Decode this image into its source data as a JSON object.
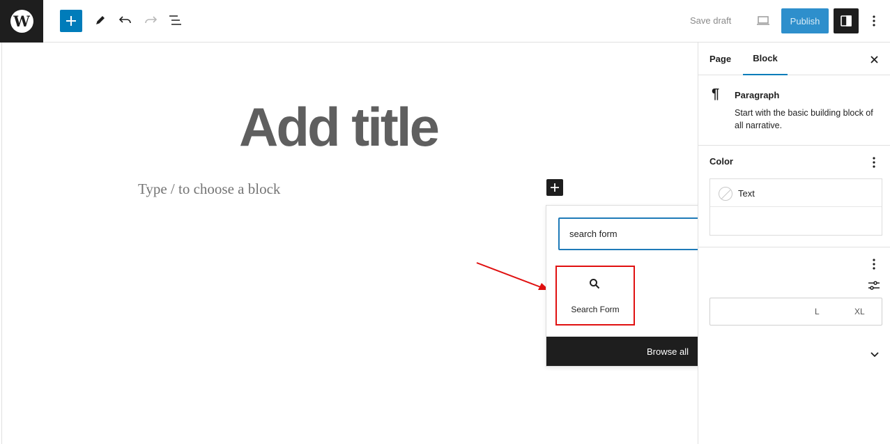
{
  "topbar": {
    "logo_icon": "wordpress-logo-icon",
    "logo_glyph": "W",
    "save_draft_label": "Save draft",
    "publish_label": "Publish",
    "icons": [
      "plus-icon",
      "pencil-icon",
      "undo-icon",
      "redo-icon",
      "list-view-icon",
      "desktop-preview-icon",
      "sidebar-toggle-icon",
      "more-vertical-icon"
    ]
  },
  "editor": {
    "title_placeholder": "Add title",
    "paragraph_placeholder": "Type / to choose a block"
  },
  "inserter": {
    "search_value": "search form",
    "results": [
      {
        "label": "Search Form",
        "icon": "search-icon"
      }
    ],
    "browse_all_label": "Browse all"
  },
  "annotation": {
    "color": "#e01010"
  },
  "sidebar": {
    "tabs": [
      {
        "label": "Page",
        "active": false
      },
      {
        "label": "Block",
        "active": true
      }
    ],
    "block": {
      "icon": "paragraph-icon",
      "name": "Paragraph",
      "description": "Start with the basic building block of all narrative."
    },
    "color": {
      "heading": "Color",
      "items": [
        "Text"
      ]
    },
    "typography": {
      "sizes": [
        "L",
        "XL"
      ]
    }
  },
  "colors": {
    "accent": "#007cba",
    "publish_bg": "#2e8fcc",
    "dark": "#1e1e1e"
  }
}
